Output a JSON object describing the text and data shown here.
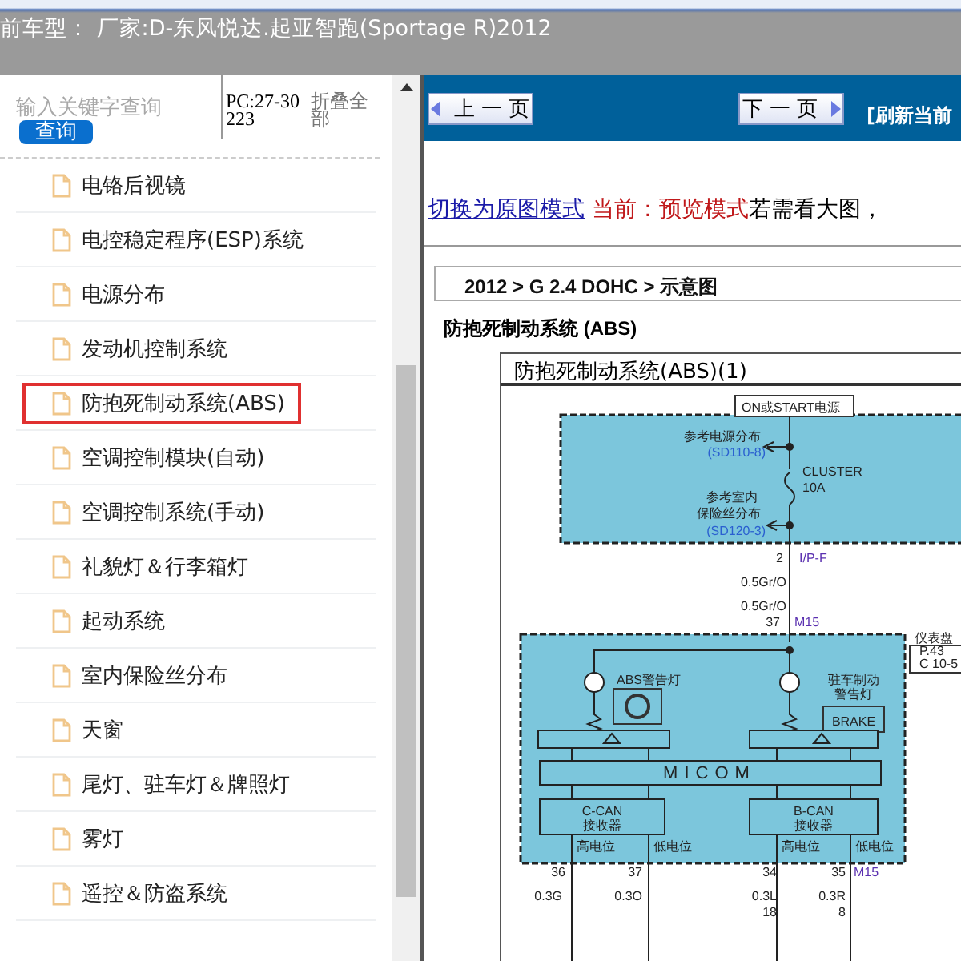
{
  "header": {
    "title": "前车型：  厂家:D-东风悦达.起亚智跑(Sportage R)2012"
  },
  "search": {
    "placeholder": "输入关键字查询",
    "button": "查询",
    "code": "PC:27-30223",
    "collapse": "折叠全部"
  },
  "tree": {
    "items": [
      {
        "label": "电铬后视镜",
        "selected": false
      },
      {
        "label": "电控稳定程序(ESP)系统",
        "selected": false
      },
      {
        "label": "电源分布",
        "selected": false
      },
      {
        "label": "发动机控制系统",
        "selected": false
      },
      {
        "label": "防抱死制动系统(ABS)",
        "selected": true
      },
      {
        "label": "空调控制模块(自动)",
        "selected": false
      },
      {
        "label": "空调控制系统(手动)",
        "selected": false
      },
      {
        "label": "礼貌灯＆行李箱灯",
        "selected": false
      },
      {
        "label": "起动系统",
        "selected": false
      },
      {
        "label": "室内保险丝分布",
        "selected": false
      },
      {
        "label": "天窗",
        "selected": false
      },
      {
        "label": "尾灯、驻车灯＆牌照灯",
        "selected": false
      },
      {
        "label": "雾灯",
        "selected": false
      },
      {
        "label": "遥控＆防盗系统",
        "selected": false
      }
    ]
  },
  "toolbar": {
    "prev": "上 一 页",
    "next": "下 一 页",
    "refresh": "[刷新当前"
  },
  "mode_line": {
    "link": "切换为原图模式",
    "current": "当前：预览模式",
    "hint": "若需看大图，"
  },
  "breadcrumb": "2012 > G 2.4 DOHC > 示意图",
  "section_title": "防抱死制动系统  (ABS)",
  "diagram": {
    "title": "防抱死制动系统(ABS)(1)",
    "labels": [
      {
        "text": "ON或START电源",
        "kind": "plain"
      },
      {
        "text": "参考电源分布",
        "kind": "plain"
      },
      {
        "text": "(SD110-8)",
        "kind": "ref"
      },
      {
        "text": "CLUSTER",
        "kind": "plain"
      },
      {
        "text": "10A",
        "kind": "plain"
      },
      {
        "text": "参考室内",
        "kind": "plain"
      },
      {
        "text": "保险丝分布",
        "kind": "plain"
      },
      {
        "text": "(SD120-3)",
        "kind": "ref"
      },
      {
        "text": "2",
        "kind": "plain"
      },
      {
        "text": "I/P-F",
        "kind": "connector"
      },
      {
        "text": "0.5Gr/O",
        "kind": "plain"
      },
      {
        "text": "0.5Gr/O",
        "kind": "plain"
      },
      {
        "text": "37",
        "kind": "plain"
      },
      {
        "text": "M15",
        "kind": "connector"
      },
      {
        "text": "仪表盘",
        "kind": "plain"
      },
      {
        "text": "P.43",
        "kind": "plain"
      },
      {
        "text": "C 10-5",
        "kind": "plain"
      },
      {
        "text": "ABS警告灯",
        "kind": "plain"
      },
      {
        "text": "驻车制动",
        "kind": "plain"
      },
      {
        "text": "警告灯",
        "kind": "plain"
      },
      {
        "text": "BRAKE",
        "kind": "plain"
      },
      {
        "text": "MICOM",
        "kind": "plain"
      },
      {
        "text": "C-CAN",
        "kind": "plain"
      },
      {
        "text": "接收器",
        "kind": "plain"
      },
      {
        "text": "B-CAN",
        "kind": "plain"
      },
      {
        "text": "接收器",
        "kind": "plain"
      },
      {
        "text": "高电位",
        "kind": "plain"
      },
      {
        "text": "低电位",
        "kind": "plain"
      },
      {
        "text": "高电位",
        "kind": "plain"
      },
      {
        "text": "低电位",
        "kind": "plain"
      },
      {
        "text": "36",
        "kind": "plain"
      },
      {
        "text": "37",
        "kind": "plain"
      },
      {
        "text": "34",
        "kind": "plain"
      },
      {
        "text": "35",
        "kind": "plain"
      },
      {
        "text": "M15",
        "kind": "connector"
      },
      {
        "text": "0.3G",
        "kind": "plain"
      },
      {
        "text": "0.3O",
        "kind": "plain"
      },
      {
        "text": "0.3L",
        "kind": "plain"
      },
      {
        "text": "0.3R",
        "kind": "plain"
      },
      {
        "text": "18",
        "kind": "plain"
      },
      {
        "text": "8",
        "kind": "plain"
      }
    ]
  }
}
